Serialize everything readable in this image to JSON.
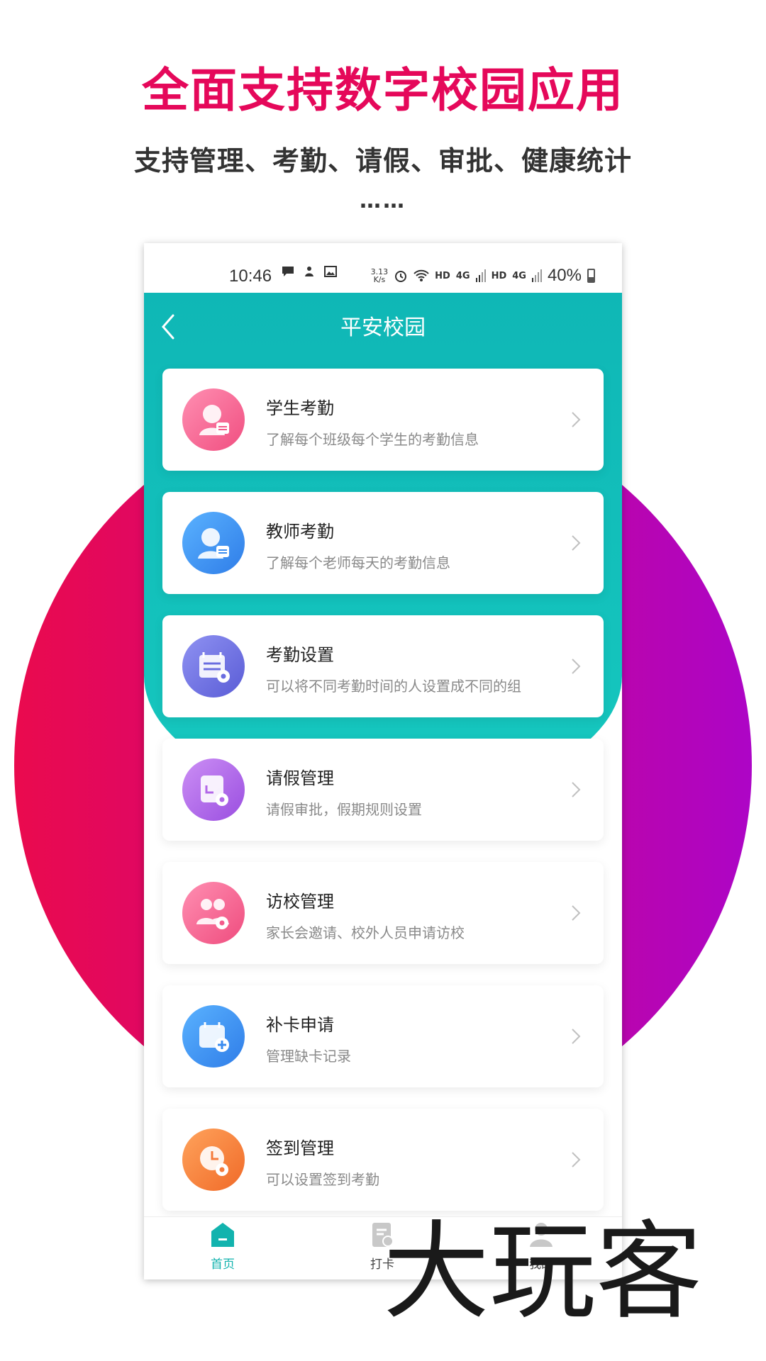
{
  "promo": {
    "headline": "全面支持数字校园应用",
    "subline": "支持管理、考勤、请假、审批、健康统计",
    "ellipsis": "……",
    "headline_color": "#e5085a"
  },
  "status_bar": {
    "time": "10:46",
    "net_speed_value": "3.13",
    "net_speed_unit": "K/s",
    "hd1": "HD",
    "net1": "4G",
    "hd2": "HD",
    "net2": "4G",
    "battery": "40%"
  },
  "nav": {
    "title": "平安校园"
  },
  "menu": [
    {
      "title": "学生考勤",
      "desc": "了解每个班级每个学生的考勤信息",
      "icon": "student-attendance-icon",
      "color": "#f35a8a"
    },
    {
      "title": "教师考勤",
      "desc": "了解每个老师每天的考勤信息",
      "icon": "teacher-attendance-icon",
      "color": "#3a8cf0"
    },
    {
      "title": "考勤设置",
      "desc": "可以将不同考勤时间的人设置成不同的组",
      "icon": "attendance-settings-icon",
      "color": "#6a6de0"
    },
    {
      "title": "请假管理",
      "desc": "请假审批，假期规则设置",
      "icon": "leave-management-icon",
      "color": "#b268e8"
    },
    {
      "title": "访校管理",
      "desc": "家长会邀请、校外人员申请访校",
      "icon": "visit-management-icon",
      "color": "#f45c8c"
    },
    {
      "title": "补卡申请",
      "desc": "管理缺卡记录",
      "icon": "card-supplement-icon",
      "color": "#3a8cf0"
    },
    {
      "title": "签到管理",
      "desc": "可以设置签到考勤",
      "icon": "sign-in-management-icon",
      "color": "#f57b3c"
    }
  ],
  "tabs": [
    {
      "label": "首页",
      "icon": "home-icon",
      "active": true
    },
    {
      "label": "打卡",
      "icon": "clock-in-icon",
      "active": false
    },
    {
      "label": "我的",
      "icon": "profile-icon",
      "active": false
    }
  ],
  "colors": {
    "teal": "#10bfba",
    "tab_active": "#12b3ae",
    "tab_inactive": "#c8c8c8"
  },
  "watermark": "大玩客"
}
